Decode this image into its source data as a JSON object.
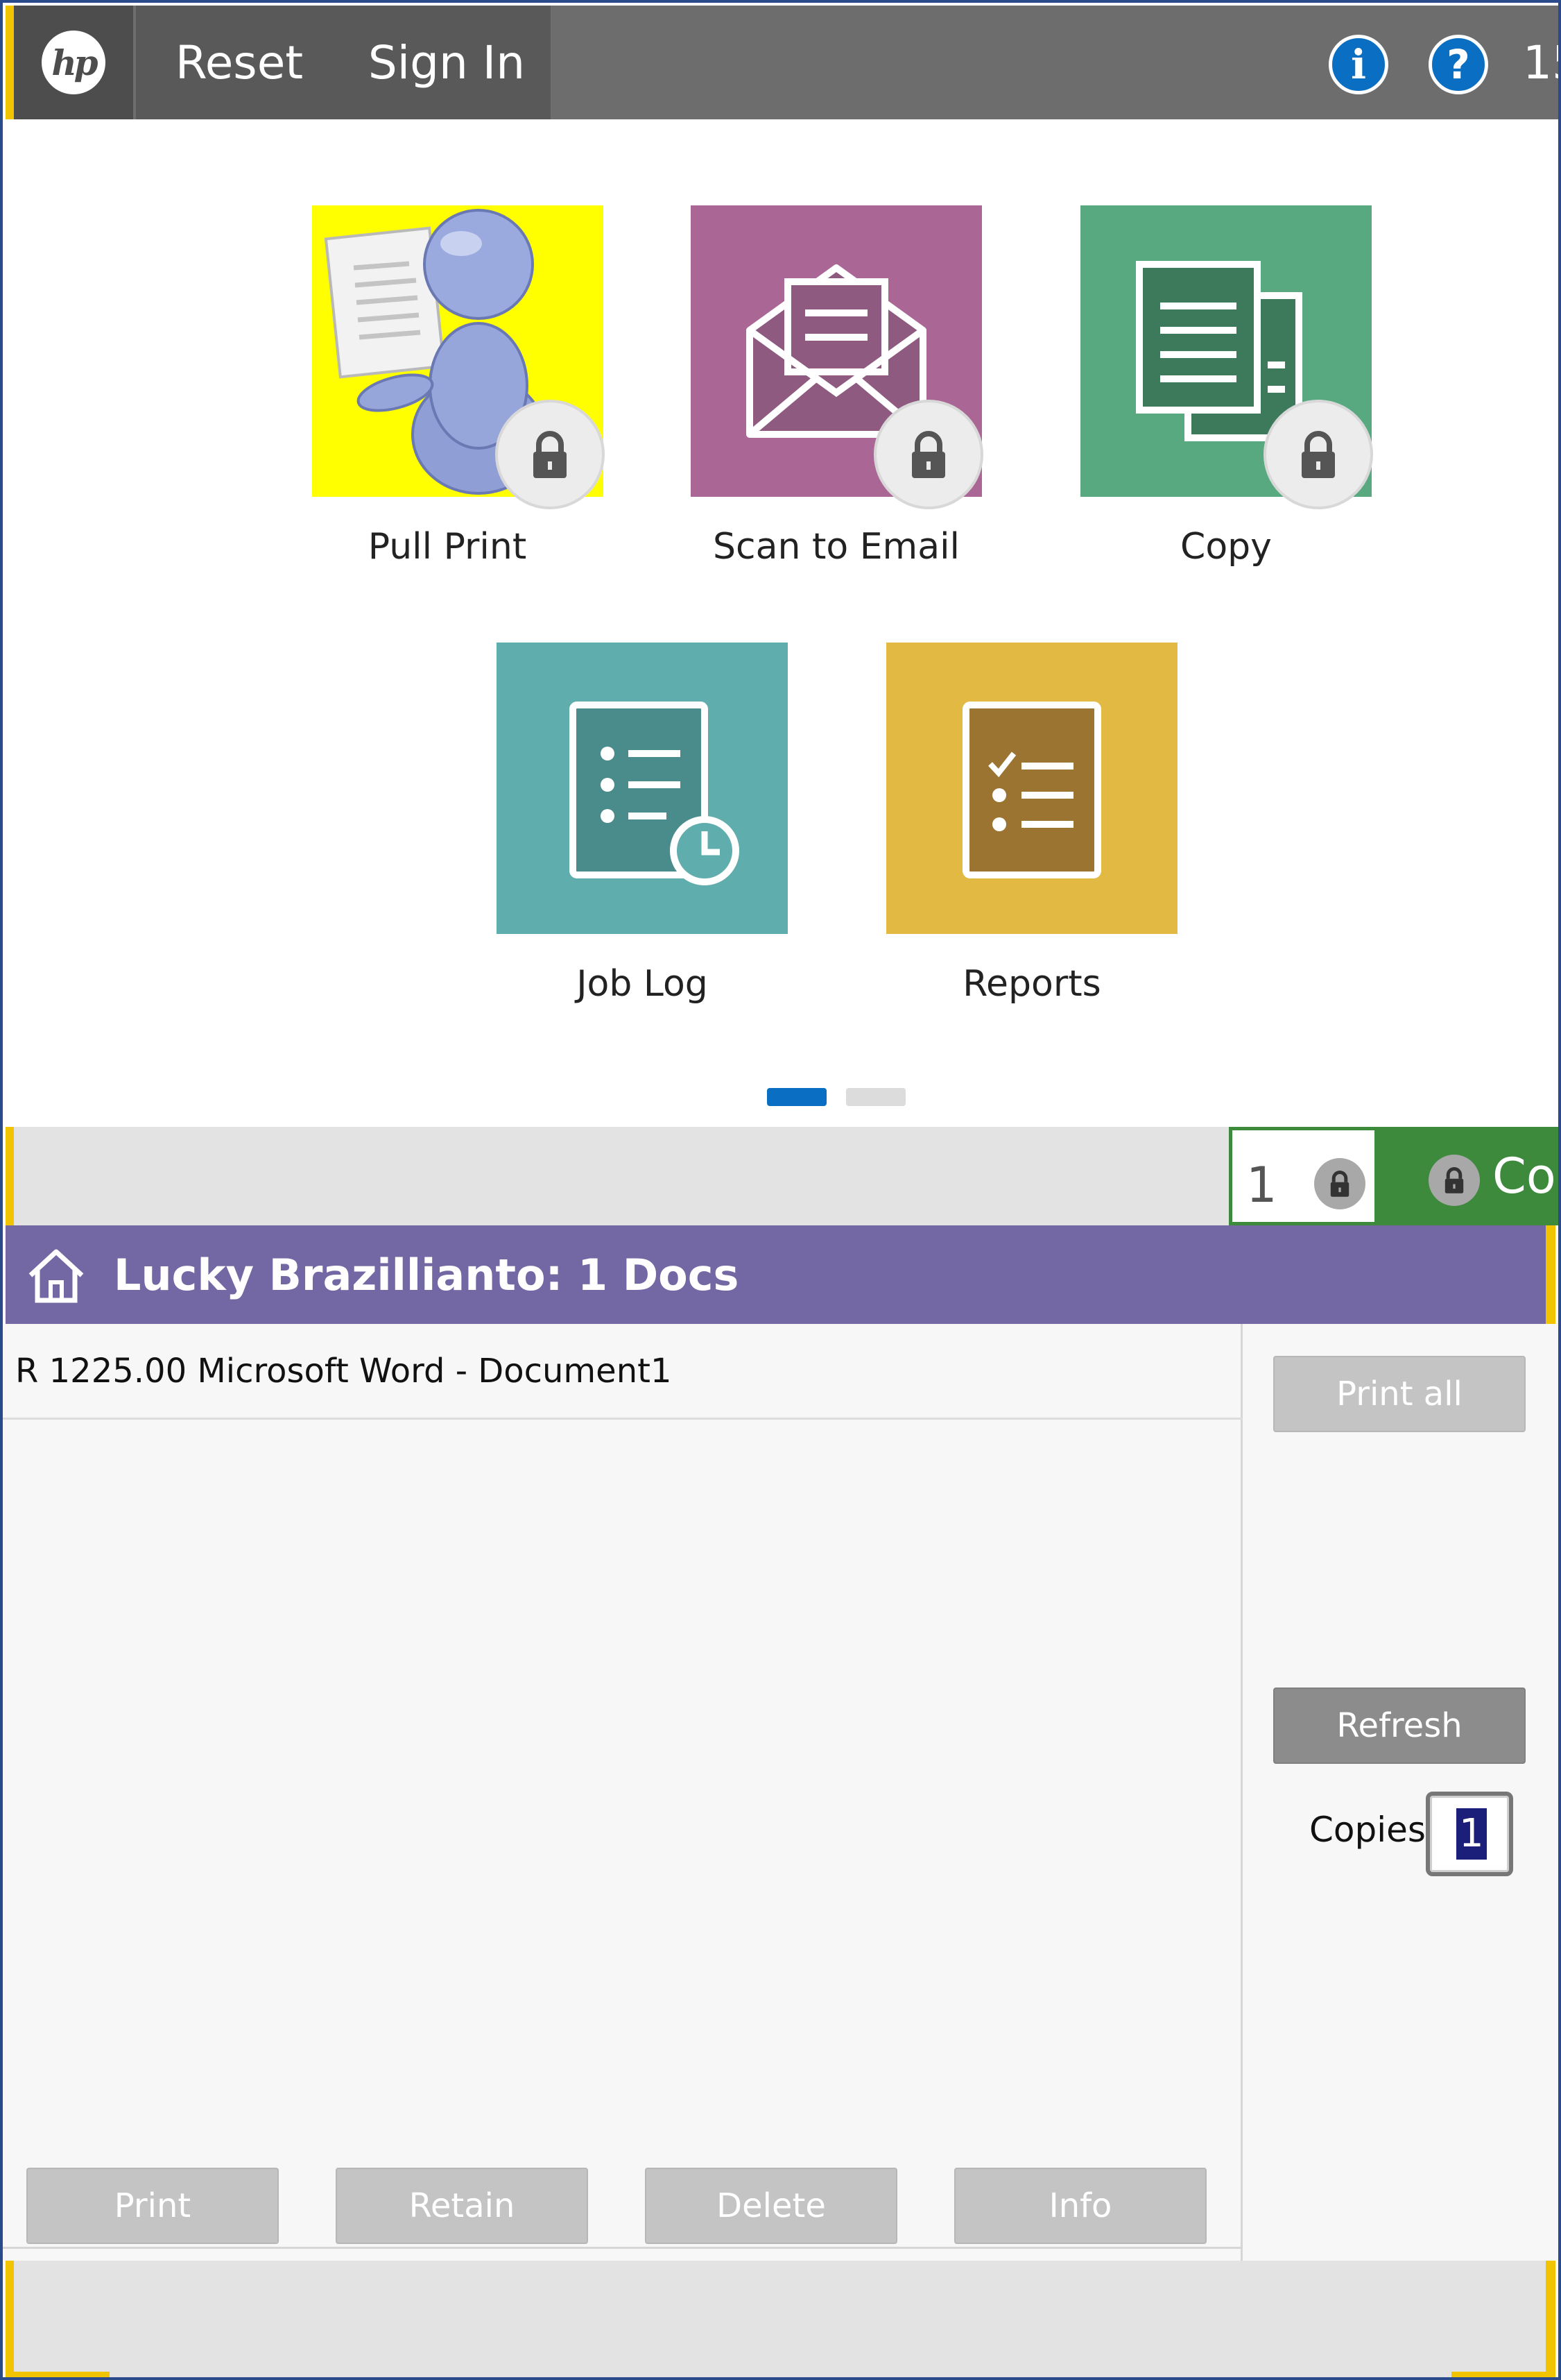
{
  "topbar": {
    "logo_text": "hp",
    "reset_label": "Reset",
    "signin_label": "Sign In",
    "info_icon": "info-icon",
    "help_icon": "help-icon",
    "clock_text": "15"
  },
  "tiles": [
    {
      "label": "Pull Print",
      "color": "#ffff00",
      "locked": true,
      "icon": "person-with-document-icon"
    },
    {
      "label": "Scan to Email",
      "color": "#aa6796",
      "locked": true,
      "icon": "envelope-icon"
    },
    {
      "label": "Copy",
      "color": "#59a980",
      "locked": true,
      "icon": "copy-documents-icon"
    },
    {
      "label": "Job Log",
      "color": "#5fadac",
      "locked": false,
      "icon": "job-log-icon"
    },
    {
      "label": "Reports",
      "color": "#e2b942",
      "locked": false,
      "icon": "reports-icon"
    }
  ],
  "pagination": {
    "current_page": 1,
    "total_pages": 2
  },
  "status_strip": {
    "counter_value": "1",
    "copy_label": "Co"
  },
  "panel": {
    "title": "Lucky Brazillianto: 1 Docs",
    "header_color": "#7468a4",
    "documents": [
      {
        "label": "R 1225.00 Microsoft Word - Document1"
      }
    ],
    "print_all_label": "Print all",
    "refresh_label": "Refresh",
    "copies_label": "Copies",
    "copies_value": "1",
    "actions": {
      "print": "Print",
      "retain": "Retain",
      "delete": "Delete",
      "info": "Info"
    }
  }
}
